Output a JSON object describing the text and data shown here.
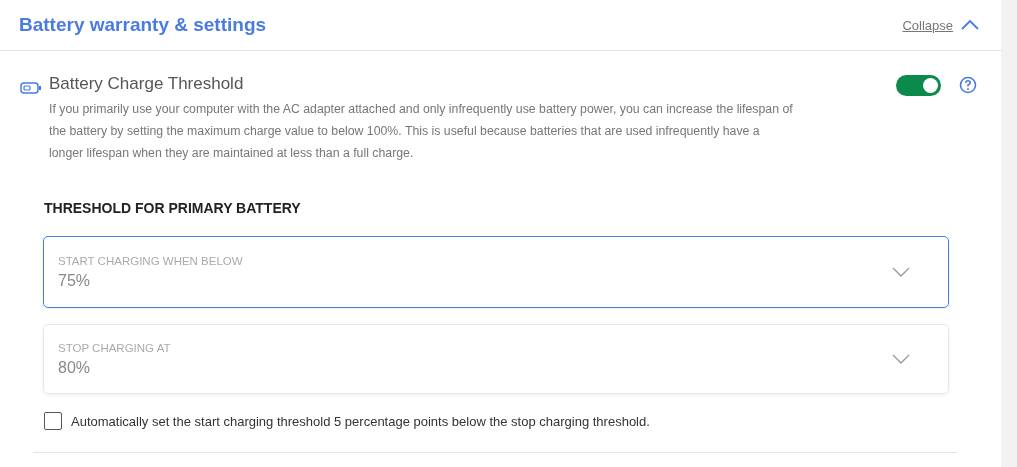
{
  "section": {
    "title": "Battery warranty & settings",
    "collapse_link": "Collapse",
    "expanded": true
  },
  "setting": {
    "title": "Battery Charge Threshold",
    "on": true,
    "description": "If you primarily use your computer with the AC adapter attached and only infrequently use battery power, you can increase the lifespan of the battery by setting the maximum charge value to below 100%. This is useful because batteries that are used infrequently have a longer lifespan when they are maintained at less than a full charge."
  },
  "threshold_heading": "THRESHOLD FOR PRIMARY BATTERY",
  "dropdowns": [
    {
      "label": "START CHARGING WHEN BELOW",
      "value": "75%",
      "focused": true
    },
    {
      "label": "STOP CHARGING AT",
      "value": "80%",
      "focused": false
    }
  ],
  "auto_option": {
    "label": "Automatically set the start charging threshold 5 percentage points below the stop charging threshold.",
    "checked": false
  }
}
